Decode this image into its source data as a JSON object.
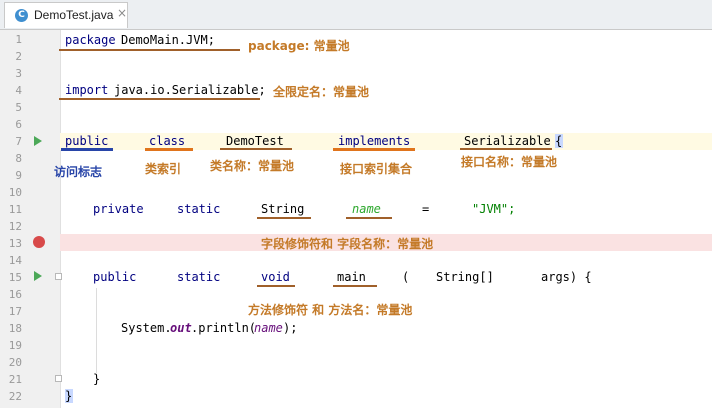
{
  "tab": {
    "icon": "java-class-icon",
    "icon_letter": "C",
    "name": "DemoTest.java",
    "close": "×"
  },
  "line_numbers": [
    "1",
    "2",
    "3",
    "4",
    "5",
    "6",
    "7",
    "8",
    "9",
    "10",
    "11",
    "12",
    "13",
    "14",
    "15",
    "16",
    "17",
    "18",
    "19",
    "20",
    "21",
    "22"
  ],
  "code": {
    "l1_kw": "package",
    "l1_rest": "DemoMain.JVM;",
    "l4_kw": "import",
    "l4_rest": "java.io.Serializable;",
    "l7_public": "public",
    "l7_class": "class",
    "l7_name": "DemoTest",
    "l7_impl": "implements",
    "l7_iface": "Serializable",
    "l7_brace": "{",
    "l11_private": "private",
    "l11_static": "static",
    "l11_type": "String",
    "l11_field": "name",
    "l11_eq": "=",
    "l11_str": "\"JVM\";",
    "l15_public": "public",
    "l15_static": "static",
    "l15_void": "void",
    "l15_main": "main",
    "l15_paren": "(",
    "l15_type": "String[]",
    "l15_args": "args) {",
    "l18_sys": "System.",
    "l18_out": "out",
    "l18_println": ".println(",
    "l18_name": "name",
    "l18_end": ");",
    "l21_brace": "}",
    "l22_brace": "}"
  },
  "annotations": {
    "package": "package: 常量池",
    "import": "全限定名：常量池",
    "access_flags": "访问标志",
    "class_index": "类索引",
    "class_name": "类名称：常量池",
    "interfaces": "接口索引集合",
    "interface_name": "接口名称：常量池",
    "field": "字段修饰符和 字段名称：常量池",
    "method": "方法修饰符 和 方法名：常量池"
  }
}
